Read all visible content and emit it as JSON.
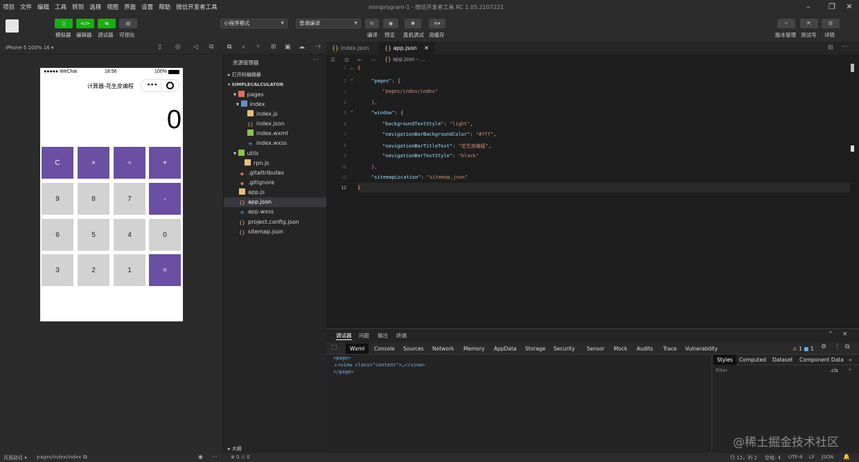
{
  "menu": [
    "项目",
    "文件",
    "编辑",
    "工具",
    "转到",
    "选择",
    "视图",
    "界面",
    "设置",
    "帮助",
    "微信开发者工具"
  ],
  "window_title": "miniprogram-1 - 微信开发者工具 RC 1.05.2107221",
  "toolbar": {
    "simulator_label": "模拟器",
    "editor_label": "编辑器",
    "debugger_label": "调试器",
    "visual_label": "可视化",
    "mode_select": "小程序模式",
    "compile_select": "普通编译",
    "compile_label": "编译",
    "preview_label": "预览",
    "realdevice_label": "真机调试",
    "clearcache_label": "清缓存",
    "version_label": "版本管理",
    "test_label": "测试号",
    "details_label": "详情"
  },
  "device_info": "iPhone 5 100% 16 ▾",
  "phone": {
    "carrier": "●●●●● WeChat",
    "time": "18:56",
    "battery": "100%",
    "nav_title": "计算器-花生皮编程",
    "capsule_dots": "•••",
    "display_value": "0",
    "keys": [
      [
        "C",
        "×",
        "÷",
        "+"
      ],
      [
        "9",
        "8",
        "7",
        "-"
      ],
      [
        "6",
        "5",
        "4",
        "0"
      ],
      [
        "3",
        "2",
        "1",
        "="
      ]
    ]
  },
  "explorer": {
    "header": "资源管理器",
    "open_editors": "打开的编辑器",
    "project": "SIMPLECALCULATOR",
    "items": {
      "pages": "pages",
      "index": "index",
      "index_js": "index.js",
      "index_json": "index.json",
      "index_wxml": "index.wxml",
      "index_wxss": "index.wxss",
      "utils": "utils",
      "rpn_js": "rpn.js",
      "gitattributes": ".gitattributes",
      "gitignore": ".gitignore",
      "app_js": "app.js",
      "app_json": "app.json",
      "app_wxss": "app.wxss",
      "project_config": "project.config.json",
      "sitemap": "sitemap.json"
    },
    "outline": "大纲"
  },
  "editor": {
    "tabs": [
      "index.json",
      "app.json"
    ],
    "breadcrumb": "app.json › ...",
    "line_numbers": [
      "1",
      "2",
      "3",
      "4",
      "5",
      "6",
      "7",
      "8",
      "9",
      "10",
      "11",
      "12"
    ],
    "code": {
      "l1": "{",
      "l2_key": "\"pages\"",
      "l2_rest": ": [",
      "l3": "\"pages/index/index\"",
      "l4": "],",
      "l5_key": "\"window\"",
      "l5_rest": ": {",
      "l6_key": "\"backgroundTextStyle\"",
      "l6_val": "\"light\"",
      "l7_key": "\"navigationBarBackgroundColor\"",
      "l7_val": "\"#fff\"",
      "l8_key": "\"navigationBarTitleText\"",
      "l8_val": "\"花生皮编程\"",
      "l9_key": "\"navigationBarTextStyle\"",
      "l9_val": "\"black\"",
      "l10": "},",
      "l11_key": "\"sitemapLocation\"",
      "l11_val": "\"sitemap.json\"",
      "l12": "}"
    }
  },
  "devtools": {
    "top_tabs": [
      "调试器",
      "问题",
      "输出",
      "终端"
    ],
    "panel_tabs": [
      "Wxml",
      "Console",
      "Sources",
      "Network",
      "Memory",
      "AppData",
      "Storage",
      "Security",
      "Sensor",
      "Mock",
      "Audits",
      "Trace",
      "Vulnerability"
    ],
    "warn_count": "1",
    "info_count": "1",
    "tree": [
      "<page>",
      "▸<view class=\"content\">…</view>",
      "</page>"
    ],
    "style_tabs": [
      "Styles",
      "Computed",
      "Dataset",
      "Component Data"
    ],
    "filter": "Filter",
    "cls": ".cls"
  },
  "statusbar": {
    "page_path_label": "页面路径 ▾",
    "page_path": "pages/index/index",
    "errors": "⊗ 0 ⚠ 0",
    "cursor": "行 12，列 2",
    "spaces": "空格: 4",
    "encoding": "UTF-8",
    "eol": "LF",
    "lang": "JSON"
  },
  "watermark": "@稀土掘金技术社区",
  "colors": {
    "accent_green": "#1aad19",
    "key_purple": "#6a4fa3",
    "key_gray": "#d2d2d2"
  }
}
